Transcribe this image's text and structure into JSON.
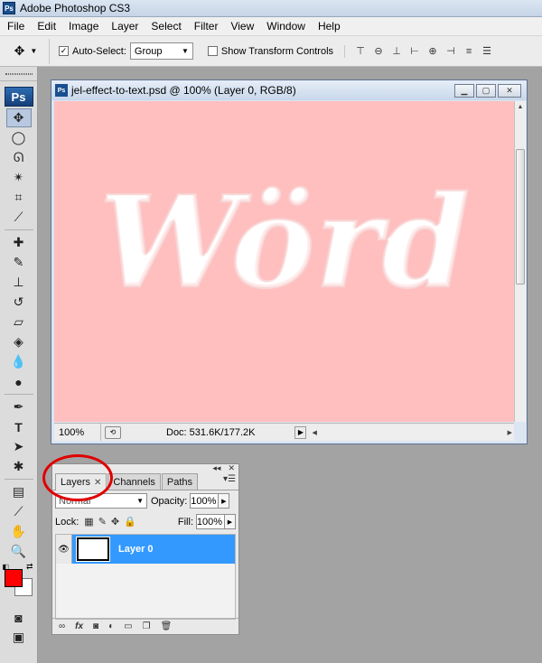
{
  "app": {
    "title": "Adobe Photoshop CS3",
    "icon_label": "Ps"
  },
  "menu": [
    "File",
    "Edit",
    "Image",
    "Layer",
    "Select",
    "Filter",
    "View",
    "Window",
    "Help"
  ],
  "options": {
    "auto_select_label": "Auto-Select:",
    "auto_select_checked": true,
    "auto_select_value": "Group",
    "show_transform_label": "Show Transform Controls",
    "show_transform_checked": false
  },
  "toolbox": {
    "logo": "Ps"
  },
  "document": {
    "title": "jel-effect-to-text.psd @ 100% (Layer 0, RGB/8)",
    "canvas_color": "#ffbfbf",
    "canvas_text": "Wörd",
    "zoom": "100%",
    "doc_info": "Doc: 531.6K/177.2K"
  },
  "layers_panel": {
    "tabs": [
      "Layers",
      "Channels",
      "Paths"
    ],
    "active_tab": "Layers",
    "blend_mode": "Normal",
    "opacity_label": "Opacity:",
    "opacity_value": "100%",
    "lock_label": "Lock:",
    "fill_label": "Fill:",
    "fill_value": "100%",
    "layers": [
      {
        "name": "Layer 0",
        "visible": true,
        "selected": true
      }
    ]
  },
  "colors": {
    "foreground": "#ff0000",
    "background": "#ffffff",
    "selection": "#3399ff",
    "annotation": "#e00000"
  }
}
